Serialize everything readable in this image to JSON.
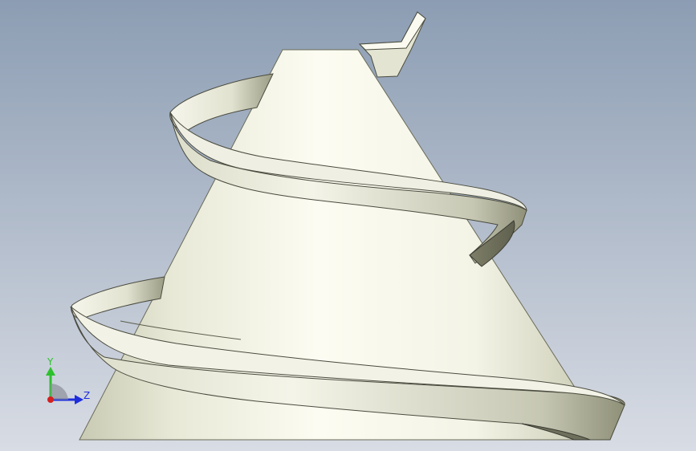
{
  "viewport": {
    "background": {
      "top_color": "#8C9DB3",
      "bottom_color": "#D8DCE4"
    },
    "model": {
      "description_name": "helical-screw-on-cone",
      "cone_color_light": "#F7F7EB",
      "cone_color_dark": "#B7B89F",
      "helix_color_light": "#F0F0E2",
      "helix_color_mid": "#D1D2BF",
      "helix_color_dark": "#85866F",
      "edge_color": "#3A3A32"
    },
    "triad": {
      "y_label": "Y",
      "z_label": "Z",
      "y_color": "#2DC12D",
      "z_color": "#1E2DDB",
      "x_color": "#D32020"
    }
  }
}
